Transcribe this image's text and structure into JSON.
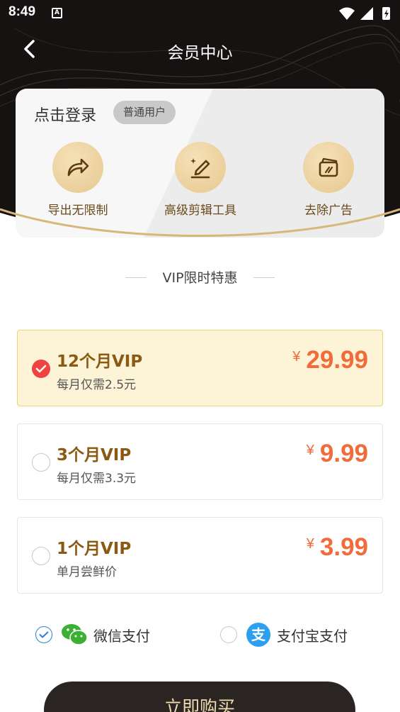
{
  "status_bar": {
    "time": "8:49",
    "notif_glyph": "A"
  },
  "nav": {
    "title": "会员中心"
  },
  "member": {
    "login_text": "点击登录",
    "user_type": "普通用户",
    "features": [
      {
        "label": "导出无限制",
        "icon": "share-arrow-icon"
      },
      {
        "label": "高级剪辑工具",
        "icon": "edit-pen-icon"
      },
      {
        "label": "去除广告",
        "icon": "remove-ad-icon"
      }
    ]
  },
  "section": {
    "title": "VIP限时特惠"
  },
  "plans": [
    {
      "name": "12个月VIP",
      "sub": "每月仅需2.5元",
      "currency": "¥",
      "price": "29.99",
      "selected": true
    },
    {
      "name": "3个月VIP",
      "sub": "每月仅需3.3元",
      "currency": "¥",
      "price": "9.99",
      "selected": false
    },
    {
      "name": "1个月VIP",
      "sub": "单月尝鲜价",
      "currency": "¥",
      "price": "3.99",
      "selected": false
    }
  ],
  "payment": {
    "wechat": {
      "label": "微信支付",
      "selected": true
    },
    "alipay": {
      "label": "支付宝支付",
      "selected": false,
      "glyph": "支"
    }
  },
  "buy_button": {
    "label": "立即购买"
  },
  "colors": {
    "accent_price": "#f26b3a",
    "plan_name": "#8b5a12",
    "hero_bg": "#161212",
    "gold": "#e7c88f"
  }
}
